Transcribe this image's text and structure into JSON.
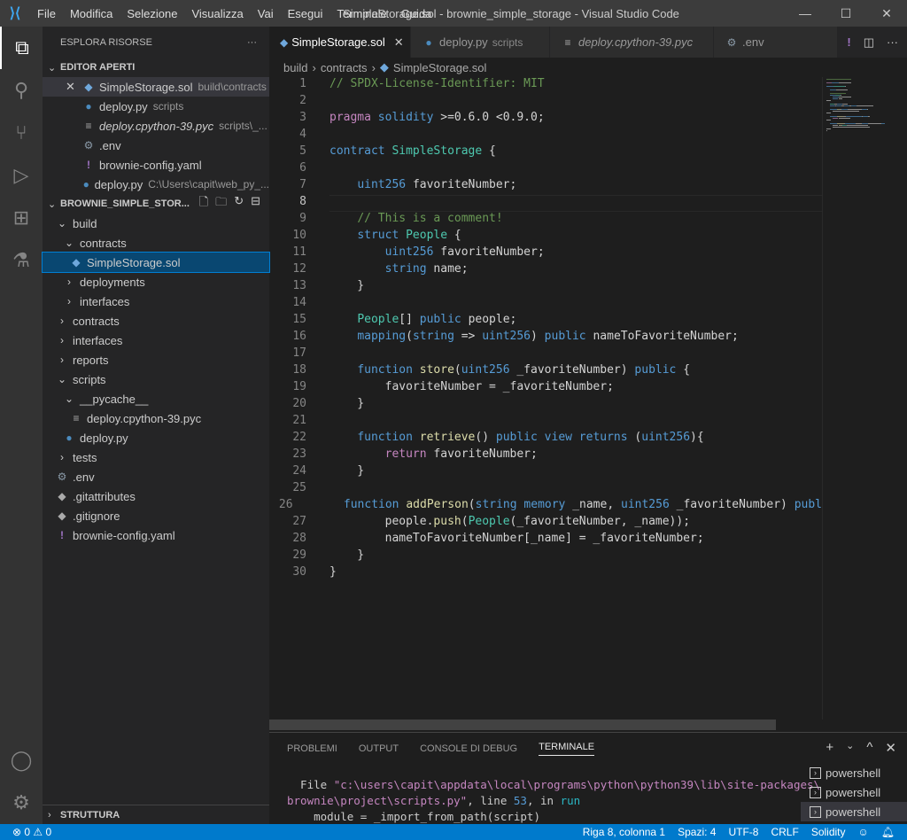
{
  "titlebar": {
    "menu": [
      "File",
      "Modifica",
      "Selezione",
      "Visualizza",
      "Vai",
      "Esegui",
      "Terminale",
      "Guida"
    ],
    "title": "SimpleStorage.sol - brownie_simple_storage - Visual Studio Code"
  },
  "sidebar": {
    "title": "ESPLORA RISORSE",
    "more": "···",
    "open_editors": {
      "title": "EDITOR APERTI",
      "items": [
        {
          "name": "SimpleStorage.sol",
          "desc": "build\\contracts",
          "icon": "sol"
        },
        {
          "name": "deploy.py",
          "desc": "scripts",
          "icon": "py"
        },
        {
          "name": "deploy.cpython-39.pyc",
          "desc": "scripts\\_...",
          "icon": "txt"
        },
        {
          "name": ".env",
          "desc": "",
          "icon": "gear"
        },
        {
          "name": "brownie-config.yaml",
          "desc": "",
          "icon": "yaml"
        },
        {
          "name": "deploy.py",
          "desc": "C:\\Users\\capit\\web_py_...",
          "icon": "py"
        }
      ]
    },
    "project": {
      "title": "BROWNIE_SIMPLE_STOR...",
      "tree": [
        {
          "name": "build",
          "level": 0,
          "type": "folder"
        },
        {
          "name": "contracts",
          "level": 1,
          "type": "folder"
        },
        {
          "name": "SimpleStorage.sol",
          "level": 2,
          "type": "sol"
        },
        {
          "name": "deployments",
          "level": 1,
          "type": "closed"
        },
        {
          "name": "interfaces",
          "level": 1,
          "type": "closed"
        },
        {
          "name": "contracts",
          "level": 0,
          "type": "closed"
        },
        {
          "name": "interfaces",
          "level": 0,
          "type": "closed"
        },
        {
          "name": "reports",
          "level": 0,
          "type": "closed"
        },
        {
          "name": "scripts",
          "level": 0,
          "type": "folder"
        },
        {
          "name": "__pycache__",
          "level": 1,
          "type": "folder"
        },
        {
          "name": "deploy.cpython-39.pyc",
          "level": 2,
          "type": "txt"
        },
        {
          "name": "deploy.py",
          "level": 1,
          "type": "py"
        },
        {
          "name": "tests",
          "level": 0,
          "type": "closed"
        },
        {
          "name": ".env",
          "level": 0,
          "type": "gear"
        },
        {
          "name": ".gitattributes",
          "level": 0,
          "type": "git"
        },
        {
          "name": ".gitignore",
          "level": 0,
          "type": "git"
        },
        {
          "name": "brownie-config.yaml",
          "level": 0,
          "type": "yaml"
        }
      ]
    },
    "outline": "STRUTTURA"
  },
  "tabs": [
    {
      "name": "SimpleStorage.sol",
      "desc": "",
      "icon": "sol"
    },
    {
      "name": "deploy.py",
      "desc": "scripts",
      "icon": "py"
    },
    {
      "name": "deploy.cpython-39.pyc",
      "desc": "",
      "icon": "txt"
    },
    {
      "name": ".env",
      "desc": "",
      "icon": "gear"
    }
  ],
  "breadcrumb": [
    "build",
    "contracts",
    "SimpleStorage.sol"
  ],
  "code": [
    [
      [
        "c",
        "// SPDX-License-Identifier: MIT"
      ]
    ],
    [],
    [
      [
        "p",
        "pragma "
      ],
      [
        "k",
        "solidity "
      ],
      [
        "d",
        ">=0.6.0 <0.9.0;"
      ]
    ],
    [],
    [
      [
        "k",
        "contract "
      ],
      [
        "t",
        "SimpleStorage "
      ],
      [
        "d",
        "{"
      ]
    ],
    [],
    [
      [
        "d",
        "    "
      ],
      [
        "k",
        "uint256 "
      ],
      [
        "v",
        "favoriteNumber;"
      ]
    ],
    [],
    [
      [
        "d",
        "    "
      ],
      [
        "c",
        "// This is a comment!"
      ]
    ],
    [
      [
        "d",
        "    "
      ],
      [
        "k",
        "struct "
      ],
      [
        "t",
        "People "
      ],
      [
        "d",
        "{"
      ]
    ],
    [
      [
        "d",
        "        "
      ],
      [
        "k",
        "uint256 "
      ],
      [
        "v",
        "favoriteNumber;"
      ]
    ],
    [
      [
        "d",
        "        "
      ],
      [
        "k",
        "string "
      ],
      [
        "v",
        "name;"
      ]
    ],
    [
      [
        "d",
        "    }"
      ]
    ],
    [],
    [
      [
        "d",
        "    "
      ],
      [
        "t",
        "People"
      ],
      [
        "d",
        "[] "
      ],
      [
        "k",
        "public "
      ],
      [
        "v",
        "people;"
      ]
    ],
    [
      [
        "d",
        "    "
      ],
      [
        "k",
        "mapping"
      ],
      [
        "d",
        "("
      ],
      [
        "k",
        "string "
      ],
      [
        "d",
        "=> "
      ],
      [
        "k",
        "uint256"
      ],
      [
        "d",
        ") "
      ],
      [
        "k",
        "public "
      ],
      [
        "v",
        "nameToFavoriteNumber;"
      ]
    ],
    [],
    [
      [
        "d",
        "    "
      ],
      [
        "k",
        "function "
      ],
      [
        "f",
        "store"
      ],
      [
        "d",
        "("
      ],
      [
        "k",
        "uint256 "
      ],
      [
        "v",
        "_favoriteNumber"
      ],
      [
        "d",
        ") "
      ],
      [
        "k",
        "public "
      ],
      [
        "d",
        "{"
      ]
    ],
    [
      [
        "d",
        "        "
      ],
      [
        "v",
        "favoriteNumber = _favoriteNumber;"
      ]
    ],
    [
      [
        "d",
        "    }"
      ]
    ],
    [],
    [
      [
        "d",
        "    "
      ],
      [
        "k",
        "function "
      ],
      [
        "f",
        "retrieve"
      ],
      [
        "d",
        "() "
      ],
      [
        "k",
        "public view returns "
      ],
      [
        "d",
        "("
      ],
      [
        "k",
        "uint256"
      ],
      [
        "d",
        "){"
      ]
    ],
    [
      [
        "d",
        "        "
      ],
      [
        "p",
        "return "
      ],
      [
        "v",
        "favoriteNumber;"
      ]
    ],
    [
      [
        "d",
        "    }"
      ]
    ],
    [],
    [
      [
        "d",
        "    "
      ],
      [
        "k",
        "function "
      ],
      [
        "f",
        "addPerson"
      ],
      [
        "d",
        "("
      ],
      [
        "k",
        "string memory "
      ],
      [
        "v",
        "_name, "
      ],
      [
        "k",
        "uint256 "
      ],
      [
        "v",
        "_favoriteNumber"
      ],
      [
        "d",
        ") "
      ],
      [
        "k",
        "publ"
      ]
    ],
    [
      [
        "d",
        "        "
      ],
      [
        "v",
        "people."
      ],
      [
        "f",
        "push"
      ],
      [
        "d",
        "("
      ],
      [
        "t",
        "People"
      ],
      [
        "d",
        "(_favoriteNumber, _name));"
      ]
    ],
    [
      [
        "d",
        "        "
      ],
      [
        "v",
        "nameToFavoriteNumber[_name] = _favoriteNumber;"
      ]
    ],
    [
      [
        "d",
        "    }"
      ]
    ],
    [
      [
        "d",
        "}"
      ]
    ]
  ],
  "cursor_line": 8,
  "panel": {
    "tabs": [
      "PROBLEMI",
      "OUTPUT",
      "CONSOLE DI DEBUG",
      "TERMINALE"
    ],
    "active": "TERMINALE",
    "terminal": {
      "l1_a": "  File ",
      "l1_b": "\"c:\\users\\capit\\appdata\\local\\programs\\python\\python39\\lib\\site-packages\\",
      "l2_a": "brownie\\project\\scripts.py\"",
      "l2_b": ", line ",
      "l2_c": "53",
      "l2_d": ", in ",
      "l2_e": "run",
      "l3": "    module = _import_from_path(script)"
    },
    "terminals": [
      "powershell",
      "powershell",
      "powershell"
    ]
  },
  "status": {
    "errors": "0",
    "warnings": "0",
    "position": "Riga 8, colonna 1",
    "spaces": "Spazi: 4",
    "encoding": "UTF-8",
    "eol": "CRLF",
    "language": "Solidity"
  },
  "colors": {
    "statusbar": "#007acc",
    "accent": "#007fd4"
  }
}
